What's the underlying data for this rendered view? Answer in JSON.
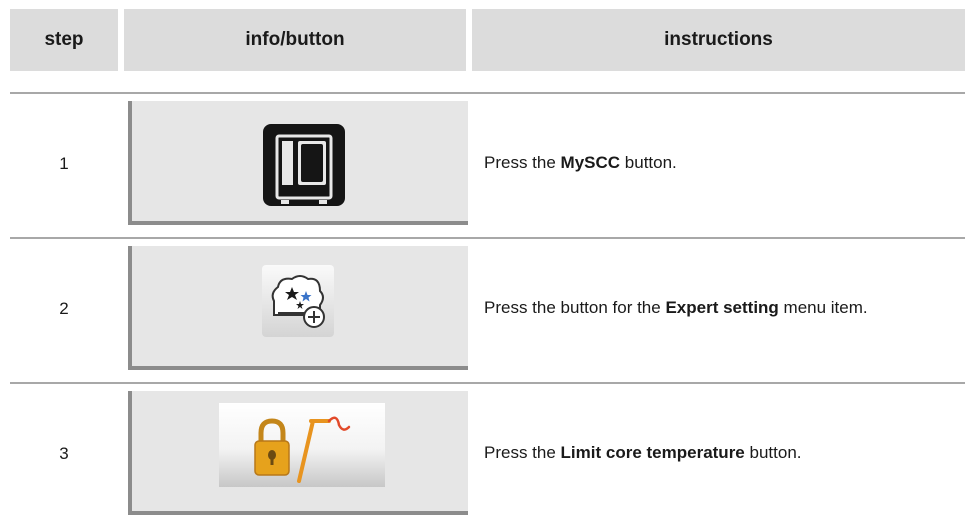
{
  "header": {
    "step": "step",
    "info": "info/button",
    "instructions": "instructions"
  },
  "rows": [
    {
      "step": "1",
      "button_icon": "combi-oven-icon",
      "instr_pre": "Press the ",
      "instr_bold": "MySCC",
      "instr_post": " button."
    },
    {
      "step": "2",
      "button_icon": "expert-setting-icon",
      "instr_pre": "Press the button for the ",
      "instr_bold": "Expert setting",
      "instr_post": " menu item."
    },
    {
      "step": "3",
      "button_icon": "lock-core-probe-icon",
      "instr_pre": "Press the ",
      "instr_bold": "Limit core temperature",
      "instr_post": " button."
    }
  ],
  "colors": {
    "header_bg": "#dcdcdc",
    "panel_bg": "#e6e6e6",
    "lock_gold": "#e6a21c",
    "probe_orange": "#e8941f"
  }
}
